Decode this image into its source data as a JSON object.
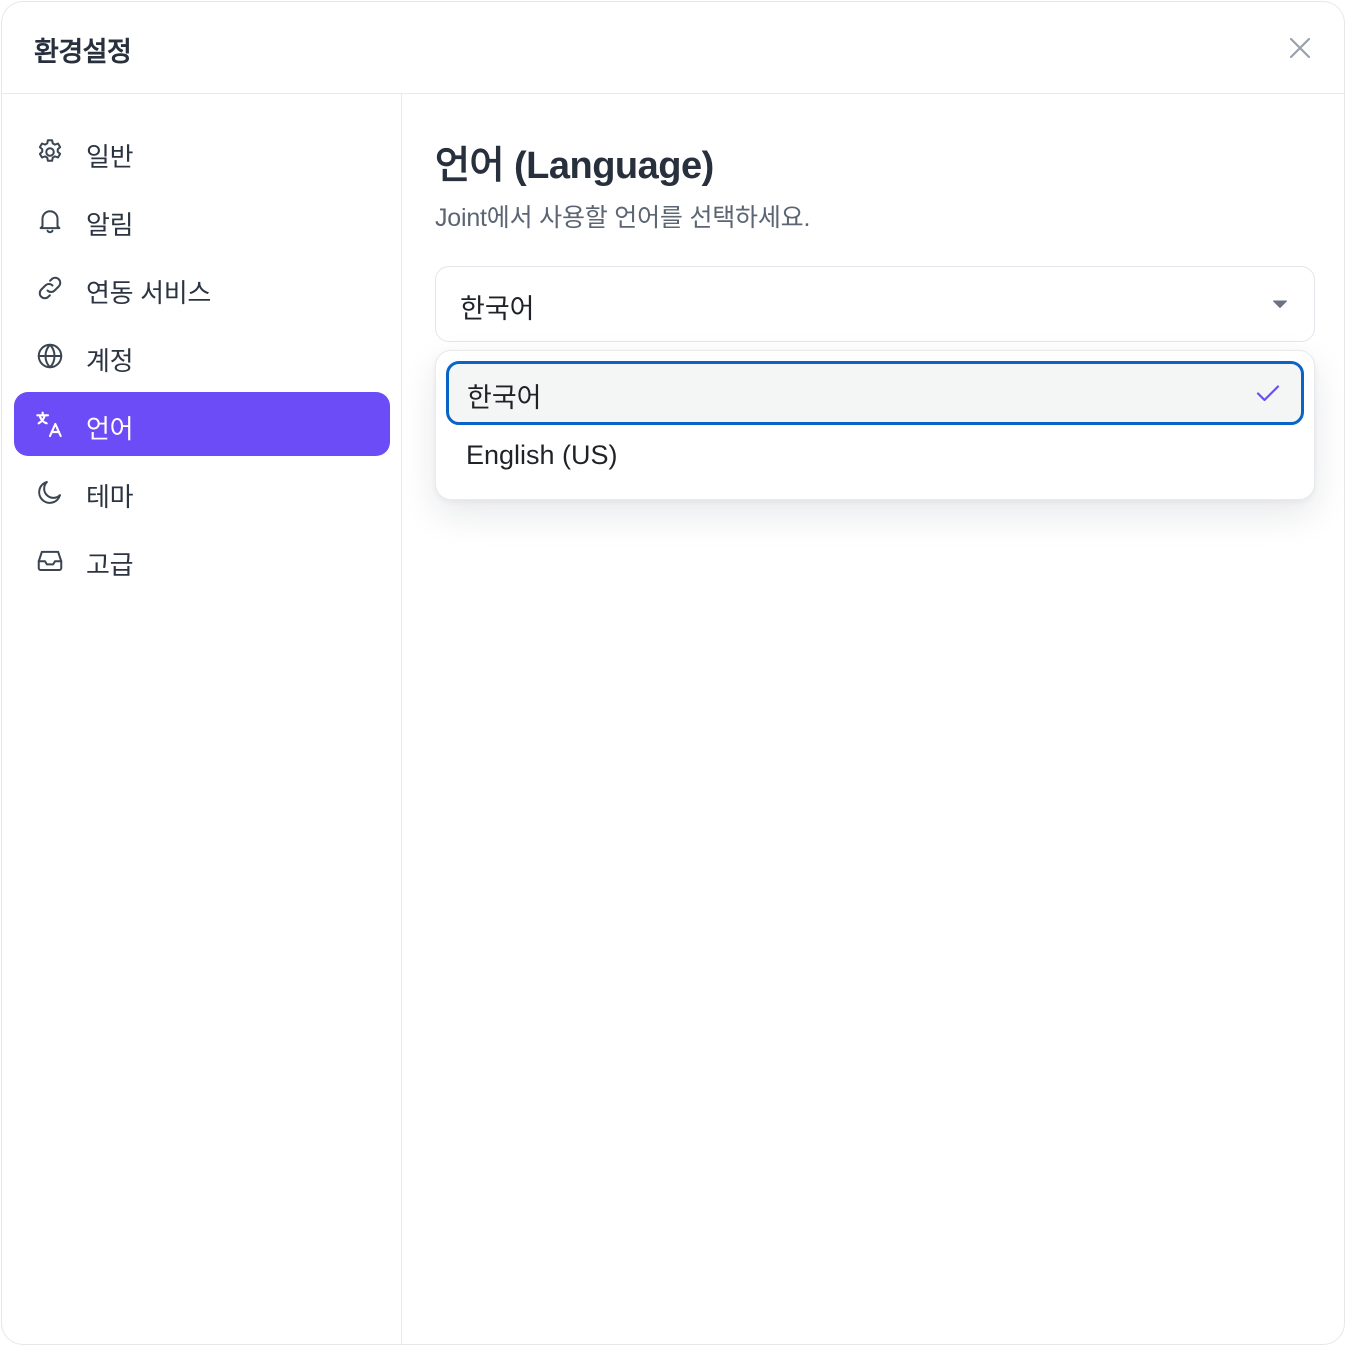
{
  "dialog": {
    "title": "환경설정",
    "close_icon": "close-icon"
  },
  "sidebar": {
    "items": [
      {
        "label": "일반",
        "icon": "gear-icon",
        "active": false
      },
      {
        "label": "알림",
        "icon": "bell-icon",
        "active": false
      },
      {
        "label": "연동 서비스",
        "icon": "link-icon",
        "active": false
      },
      {
        "label": "계정",
        "icon": "globe-icon",
        "active": false
      },
      {
        "label": "언어",
        "icon": "translate-icon",
        "active": true
      },
      {
        "label": "테마",
        "icon": "moon-icon",
        "active": false
      },
      {
        "label": "고급",
        "icon": "inbox-icon",
        "active": false
      }
    ]
  },
  "content": {
    "title": "언어 (Language)",
    "description": "Joint에서 사용할 언어를 선택하세요.",
    "select": {
      "value": "한국어",
      "options": [
        {
          "label": "한국어",
          "selected": true
        },
        {
          "label": "English (US)",
          "selected": false
        }
      ]
    }
  },
  "colors": {
    "accent": "#6c4cf6",
    "focus_ring": "#0a64c8",
    "check": "#6c4cf6"
  }
}
